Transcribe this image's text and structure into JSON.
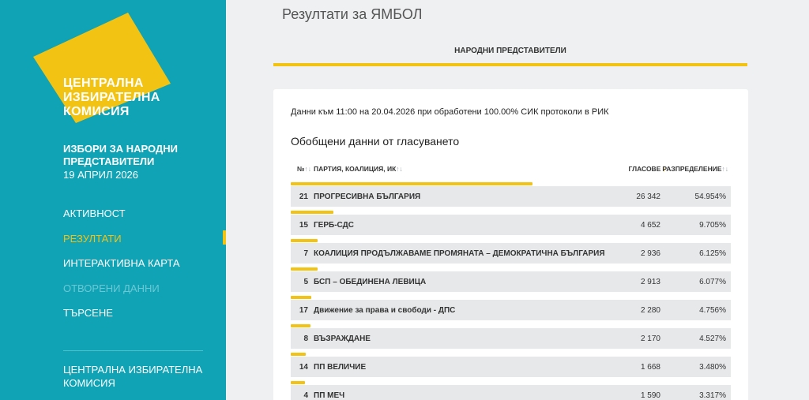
{
  "colors": {
    "sidebar_bg": "#0fa3b5",
    "accent": "#f3c314",
    "page_bg": "#eef0f2",
    "row_bg": "#e6e8ea"
  },
  "sidebar": {
    "logo_lines": [
      "ЦЕНТРАЛНА",
      "ИЗБИРАТЕЛНА",
      "КОМИСИЯ"
    ],
    "election_title": "ИЗБОРИ ЗА НАРОДНИ ПРЕДСТАВИТЕЛИ",
    "election_date": "19 АПРИЛ 2026",
    "nav": [
      {
        "label": "АКТИВНОСТ",
        "state": "normal"
      },
      {
        "label": "РЕЗУЛТАТИ",
        "state": "active"
      },
      {
        "label": "ИНТЕРАКТИВНА КАРТА",
        "state": "normal"
      },
      {
        "label": "ОТВОРЕНИ ДАННИ",
        "state": "disabled"
      },
      {
        "label": "ТЪРСЕНЕ",
        "state": "normal"
      }
    ],
    "footer_link": "ЦЕНТРАЛНА ИЗБИРАТЕЛНА КОМИСИЯ"
  },
  "main": {
    "page_title": "Резултати за ЯМБОЛ",
    "tab_label": "НАРОДНИ ПРЕДСТАВИТЕЛИ",
    "data_note": "Данни към 11:00 на 20.04.2026 при обработени 100.00% СИК протоколи в РИК",
    "summary_heading": "Обобщени данни от гласуването",
    "table": {
      "columns": {
        "num": "№",
        "party": "ПАРТИЯ, КОАЛИЦИЯ, ИК",
        "votes": "ГЛАСОВЕ",
        "dist": "РАЗПРЕДЕЛЕНИЕ"
      },
      "sort_icons": {
        "unsorted": "↑↓",
        "desc": "↓"
      },
      "rows": [
        {
          "num": "21",
          "party": "ПРОГРЕСИВНА БЪЛГАРИЯ",
          "votes": "26 342",
          "pct": "54.954%",
          "share": 0.54954
        },
        {
          "num": "15",
          "party": "ГЕРБ-СДС",
          "votes": "4 652",
          "pct": "9.705%",
          "share": 0.09705
        },
        {
          "num": "7",
          "party": "КОАЛИЦИЯ ПРОДЪЛЖАВАМЕ ПРОМЯНАТА – ДЕМОКРАТИЧНА БЪЛГАРИЯ",
          "votes": "2 936",
          "pct": "6.125%",
          "share": 0.06125
        },
        {
          "num": "5",
          "party": "БСП – ОБЕДИНЕНА ЛЕВИЦА",
          "votes": "2 913",
          "pct": "6.077%",
          "share": 0.06077
        },
        {
          "num": "17",
          "party": "Движение за права и свободи - ДПС",
          "votes": "2 280",
          "pct": "4.756%",
          "share": 0.04756
        },
        {
          "num": "8",
          "party": "ВЪЗРАЖДАНЕ",
          "votes": "2 170",
          "pct": "4.527%",
          "share": 0.04527
        },
        {
          "num": "14",
          "party": "ПП ВЕЛИЧИЕ",
          "votes": "1 668",
          "pct": "3.480%",
          "share": 0.0348
        },
        {
          "num": "4",
          "party": "ПП МЕЧ",
          "votes": "1 590",
          "pct": "3.317%",
          "share": 0.03317
        }
      ]
    }
  }
}
